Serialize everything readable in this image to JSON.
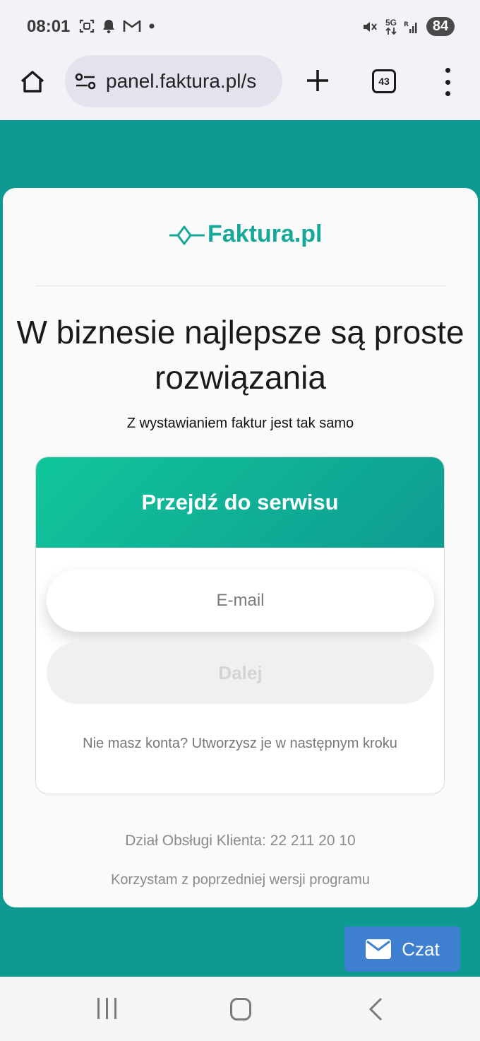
{
  "status_bar": {
    "time": "08:01",
    "battery": "84",
    "network": "5G",
    "left_icons": [
      "screenshot-icon",
      "bell-icon",
      "gmail-icon",
      "dot-icon"
    ],
    "right_icons": [
      "mute-icon",
      "data-icon",
      "signal-icon"
    ]
  },
  "browser": {
    "url": "panel.faktura.pl/s",
    "tab_count": "43"
  },
  "page": {
    "logo_text": "Faktura.pl",
    "headline": "W biznesie najlepsze są proste rozwiązania",
    "subline": "Z wystawianiem faktur jest tak samo",
    "login": {
      "title": "Przejdź do serwisu",
      "email_placeholder": "E-mail",
      "next_label": "Dalej",
      "no_account": "Nie masz konta? Utworzysz je w następnym kroku"
    },
    "support": "Dział Obsługi Klienta: 22 211 20 10",
    "old_version": "Korzystam z poprzedniej wersji programu",
    "chat_label": "Czat"
  },
  "colors": {
    "brand_teal": "#0e9a93",
    "gradient_start": "#10c69a",
    "chat_blue": "#3f7fd0"
  }
}
